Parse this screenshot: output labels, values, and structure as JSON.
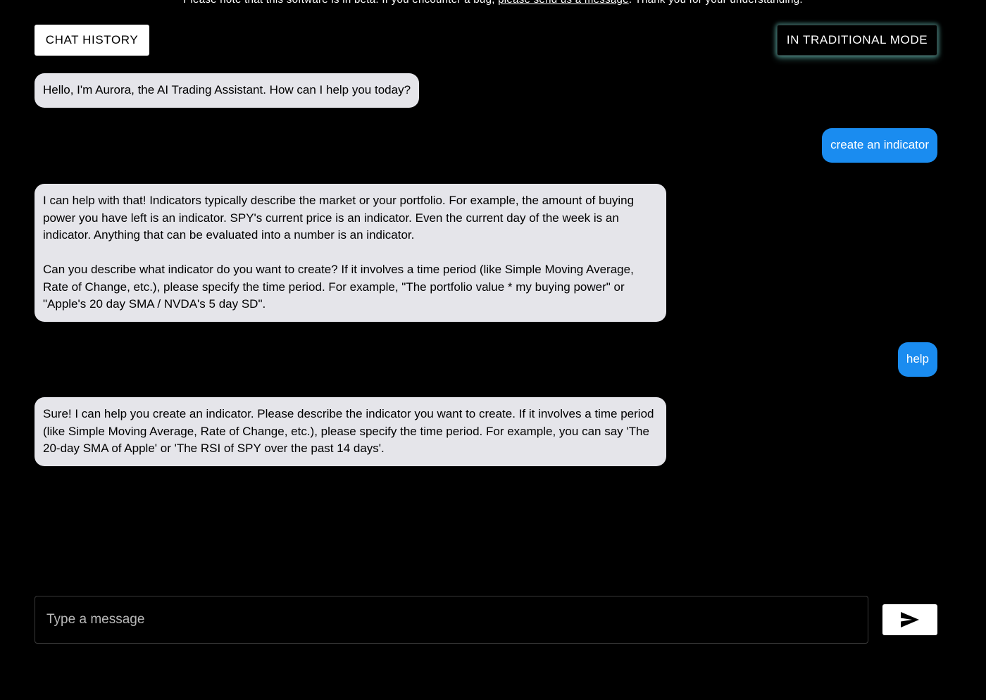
{
  "banner": {
    "text_before": "Please note that this software is in beta. If you encounter a bug, ",
    "link_text": "please send us a message",
    "text_after": ". Thank you for your understanding."
  },
  "header": {
    "chat_history_label": "CHAT HISTORY",
    "mode_label": "IN TRADITIONAL MODE"
  },
  "messages": [
    {
      "role": "assistant",
      "text": "Hello, I'm Aurora, the AI Trading Assistant. How can I help you today?"
    },
    {
      "role": "user",
      "text": "create an indicator"
    },
    {
      "role": "assistant",
      "text": "I can help with that! Indicators typically describe the market or your portfolio. For example, the amount of buying power you have left is an indicator. SPY's current price is an indicator. Even the current day of the week is an indicator. Anything that can be evaluated into a number is an indicator.\n\nCan you describe what indicator do you want to create? If it involves a time period (like Simple Moving Average, Rate of Change, etc.), please specify the time period. For example, \"The portfolio value * my buying power\" or \"Apple's 20 day SMA / NVDA's 5 day SD\"."
    },
    {
      "role": "user",
      "text": "help"
    },
    {
      "role": "assistant",
      "text": "Sure! I can help you create an indicator. Please describe the indicator you want to create. If it involves a time period (like Simple Moving Average, Rate of Change, etc.), please specify the time period. For example, you can say 'The 20-day SMA of Apple' or 'The RSI of SPY over the past 14 days'."
    }
  ],
  "composer": {
    "placeholder": "Type a message",
    "value": "",
    "send_icon": "send-icon"
  },
  "colors": {
    "background": "#000000",
    "bot_bubble": "#e5e5ea",
    "user_bubble": "#1a8cf0",
    "mode_glow": "#78dcd2"
  }
}
